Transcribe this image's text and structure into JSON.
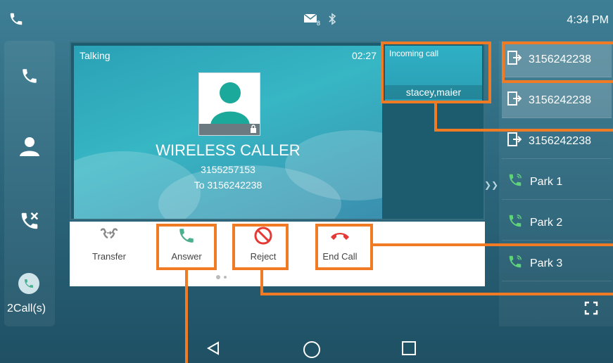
{
  "status_bar": {
    "time": "4:34 PM",
    "message_count": "8"
  },
  "left_rail": {
    "calls_label": "2Call(s)"
  },
  "active_call": {
    "state": "Talking",
    "duration": "02:27",
    "caller_name": "WIRELESS CALLER",
    "caller_number": "3155257153",
    "to_line": "To 3156242238"
  },
  "incoming_call": {
    "label": "Incoming call",
    "name": "stacey,maier"
  },
  "softkeys": [
    {
      "label": "Transfer"
    },
    {
      "label": "Answer"
    },
    {
      "label": "Reject"
    },
    {
      "label": "End Call"
    }
  ],
  "lines": [
    {
      "label": "3156242238",
      "icon": "line-key-icon"
    },
    {
      "label": "3156242238",
      "icon": "line-key-icon"
    },
    {
      "label": "3156242238",
      "icon": "line-key-icon"
    },
    {
      "label": "Park 1",
      "icon": "park-icon"
    },
    {
      "label": "Park 2",
      "icon": "park-icon"
    },
    {
      "label": "Park 3",
      "icon": "park-icon"
    }
  ],
  "colors": {
    "accent": "#f07b24",
    "answer": "#4caf8f",
    "reject": "#e53935"
  }
}
